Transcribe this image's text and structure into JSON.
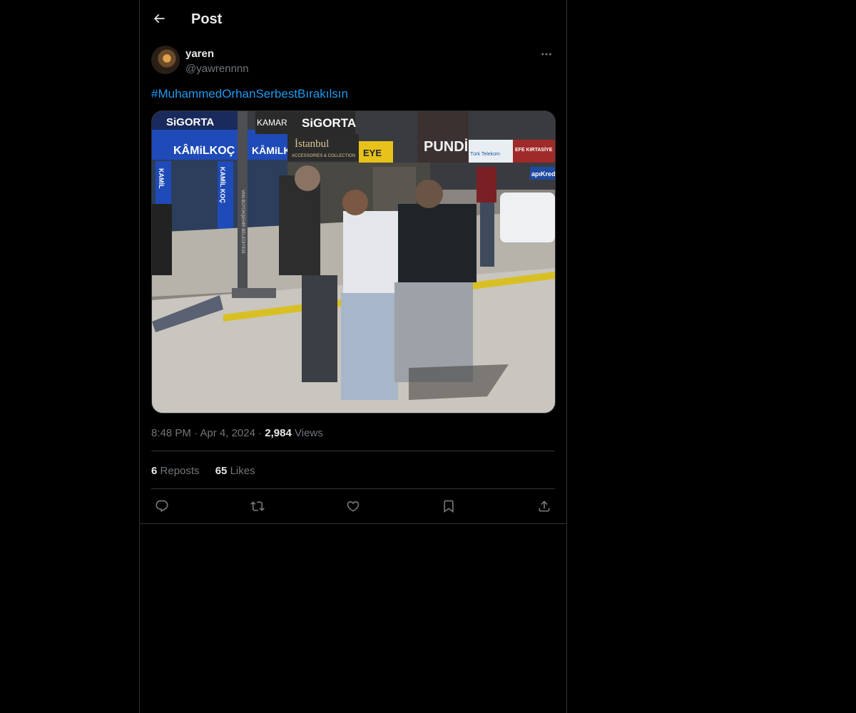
{
  "header": {
    "title": "Post",
    "back_icon": "arrow-left-icon"
  },
  "author": {
    "display_name": "yaren",
    "handle": "@yawrennnn",
    "more_icon": "more-horizontal-icon"
  },
  "tweet": {
    "hashtag": "#MuhammedOrhanSerbestBırakılsın",
    "media_signs": {
      "sigorta_left": "SiGORTA",
      "kamil_koc": "KÂMiLKOÇ",
      "kamil_koc_2": "KÂMiLKOÇ",
      "kamar": "KAMAR",
      "sigorta_right": "SiGORTA",
      "istanbul": "İstanbul",
      "accessories": "ACCESSORIES & COLLECTION",
      "pundi": "PUNDİ",
      "efe": "EFE KIRTASİYE",
      "kredi": "apıKredi",
      "turk_telekom": "Türk Telekom",
      "kamil_koc_vertical": "KAMİL KOÇ",
      "pole_text": "VAN BÜYÜKŞEHİR BELEDİYESİ",
      "eye": "EYE",
      "kamil_koc_vertical_2": "KAMİL"
    }
  },
  "meta": {
    "time": "8:48 PM",
    "sep1": "·",
    "date": "Apr 4, 2024",
    "sep2": "·",
    "views_count": "2,984",
    "views_label": "Views"
  },
  "stats": {
    "reposts_count": "6",
    "reposts_label": "Reposts",
    "likes_count": "65",
    "likes_label": "Likes"
  },
  "actions": {
    "reply_icon": "reply-icon",
    "repost_icon": "repost-icon",
    "like_icon": "heart-icon",
    "bookmark_icon": "bookmark-icon",
    "share_icon": "share-icon"
  },
  "colors": {
    "accent": "#1d9bf0",
    "text": "#e7e9ea",
    "muted": "#71767b",
    "border": "#2f3336",
    "background": "#000000"
  }
}
